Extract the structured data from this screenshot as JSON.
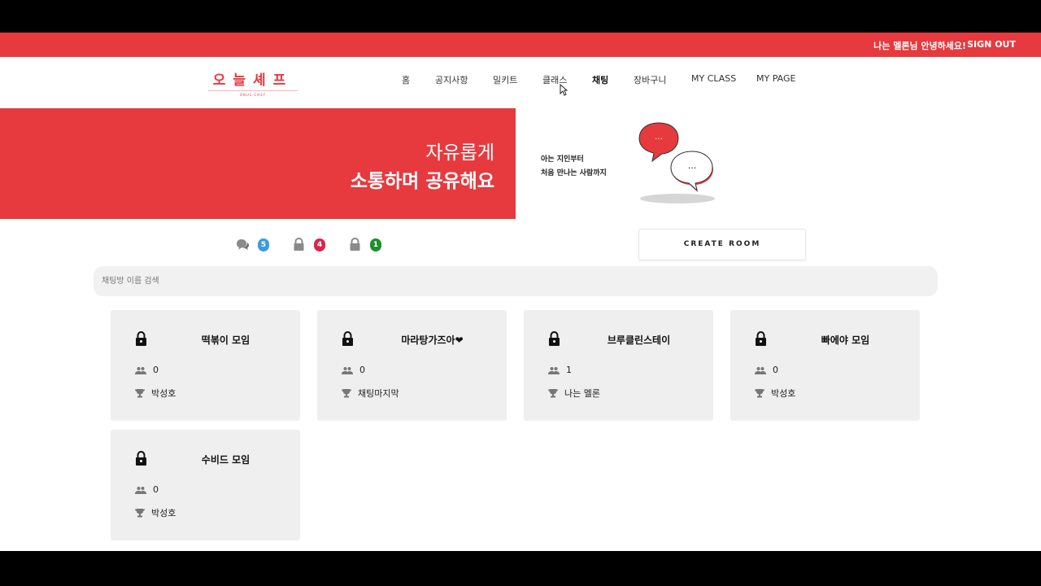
{
  "topbar": {
    "greeting": "나는 멜론님 안녕하세요!",
    "signout": "SIGN OUT"
  },
  "logo": {
    "title": "오늘셰프",
    "subtitle": "ONUL-CHEF"
  },
  "nav": [
    "홈",
    "공지사항",
    "밀키트",
    "클래스",
    "채팅",
    "장바구니",
    "MY CLASS",
    "MY PAGE"
  ],
  "nav_active": "채팅",
  "hero": {
    "line1": "자유롭게",
    "line2": "소통하며 공유해요",
    "sub1": "아는 지인부터",
    "sub2": "처음 만나는 사람까지"
  },
  "stats": [
    {
      "icon": "chat-bubbles-icon",
      "count": "5",
      "color": "#3a9be0"
    },
    {
      "icon": "lock-icon",
      "count": "4",
      "color": "#d9264a"
    },
    {
      "icon": "lock-icon",
      "count": "1",
      "color": "#1f8f2e"
    }
  ],
  "create_button": "CREATE ROOM",
  "search": {
    "placeholder": "채팅방 이름 검색",
    "value": ""
  },
  "rooms": [
    {
      "name": "떡볶이 모임",
      "members": "0",
      "owner": "박성호"
    },
    {
      "name": "마라탕가즈아❤",
      "members": "0",
      "owner": "채팅마지막"
    },
    {
      "name": "브루클린스테이",
      "members": "1",
      "owner": "나는 멜론"
    },
    {
      "name": "빠에야 모임",
      "members": "0",
      "owner": "박성호"
    },
    {
      "name": "수비드 모임",
      "members": "0",
      "owner": "박성호"
    }
  ],
  "colors": {
    "accent": "#e63a3f",
    "card": "#efefef"
  }
}
